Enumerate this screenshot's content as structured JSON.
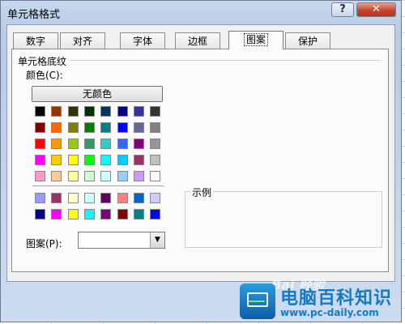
{
  "window": {
    "title": "单元格格式",
    "help_label": "?",
    "close_label": "✕"
  },
  "tabs": [
    {
      "label": "数字"
    },
    {
      "label": "对齐"
    },
    {
      "label": "字体"
    },
    {
      "label": "边框"
    },
    {
      "label": "图案",
      "active": true
    },
    {
      "label": "保护"
    }
  ],
  "shading": {
    "group_label": "单元格底纹",
    "color_label": "颜色(C):",
    "no_color_button": "无颜色",
    "palette_main": [
      [
        "#000000",
        "#993300",
        "#333300",
        "#003300",
        "#003366",
        "#000080",
        "#333399",
        "#333333"
      ],
      [
        "#800000",
        "#ff6600",
        "#808000",
        "#008000",
        "#008080",
        "#0000ff",
        "#666699",
        "#808080"
      ],
      [
        "#ff0000",
        "#ff9900",
        "#99cc00",
        "#339966",
        "#33cccc",
        "#3366ff",
        "#800080",
        "#969696"
      ],
      [
        "#ff00ff",
        "#ffcc00",
        "#ffff00",
        "#00ff00",
        "#00ffff",
        "#00ccff",
        "#993366",
        "#c0c0c0"
      ],
      [
        "#ff99cc",
        "#ffcc99",
        "#ffff99",
        "#ccffcc",
        "#ccffff",
        "#99ccff",
        "#cc99ff",
        "#ffffff"
      ]
    ],
    "palette_chart": [
      [
        "#9999ff",
        "#993366",
        "#ffffcc",
        "#ccffff",
        "#660066",
        "#ff8080",
        "#0066cc",
        "#ccccff"
      ],
      [
        "#000080",
        "#ff00ff",
        "#ffff00",
        "#00ffff",
        "#800080",
        "#800000",
        "#008080",
        "#0000ff"
      ]
    ],
    "pattern_label": "图案(P):",
    "pattern_value": "",
    "sample_label": "示例"
  },
  "watermark": {
    "title": "电脑百科知识",
    "url": "www.pc-daily.com",
    "baidu_text": "Bai 经验"
  }
}
